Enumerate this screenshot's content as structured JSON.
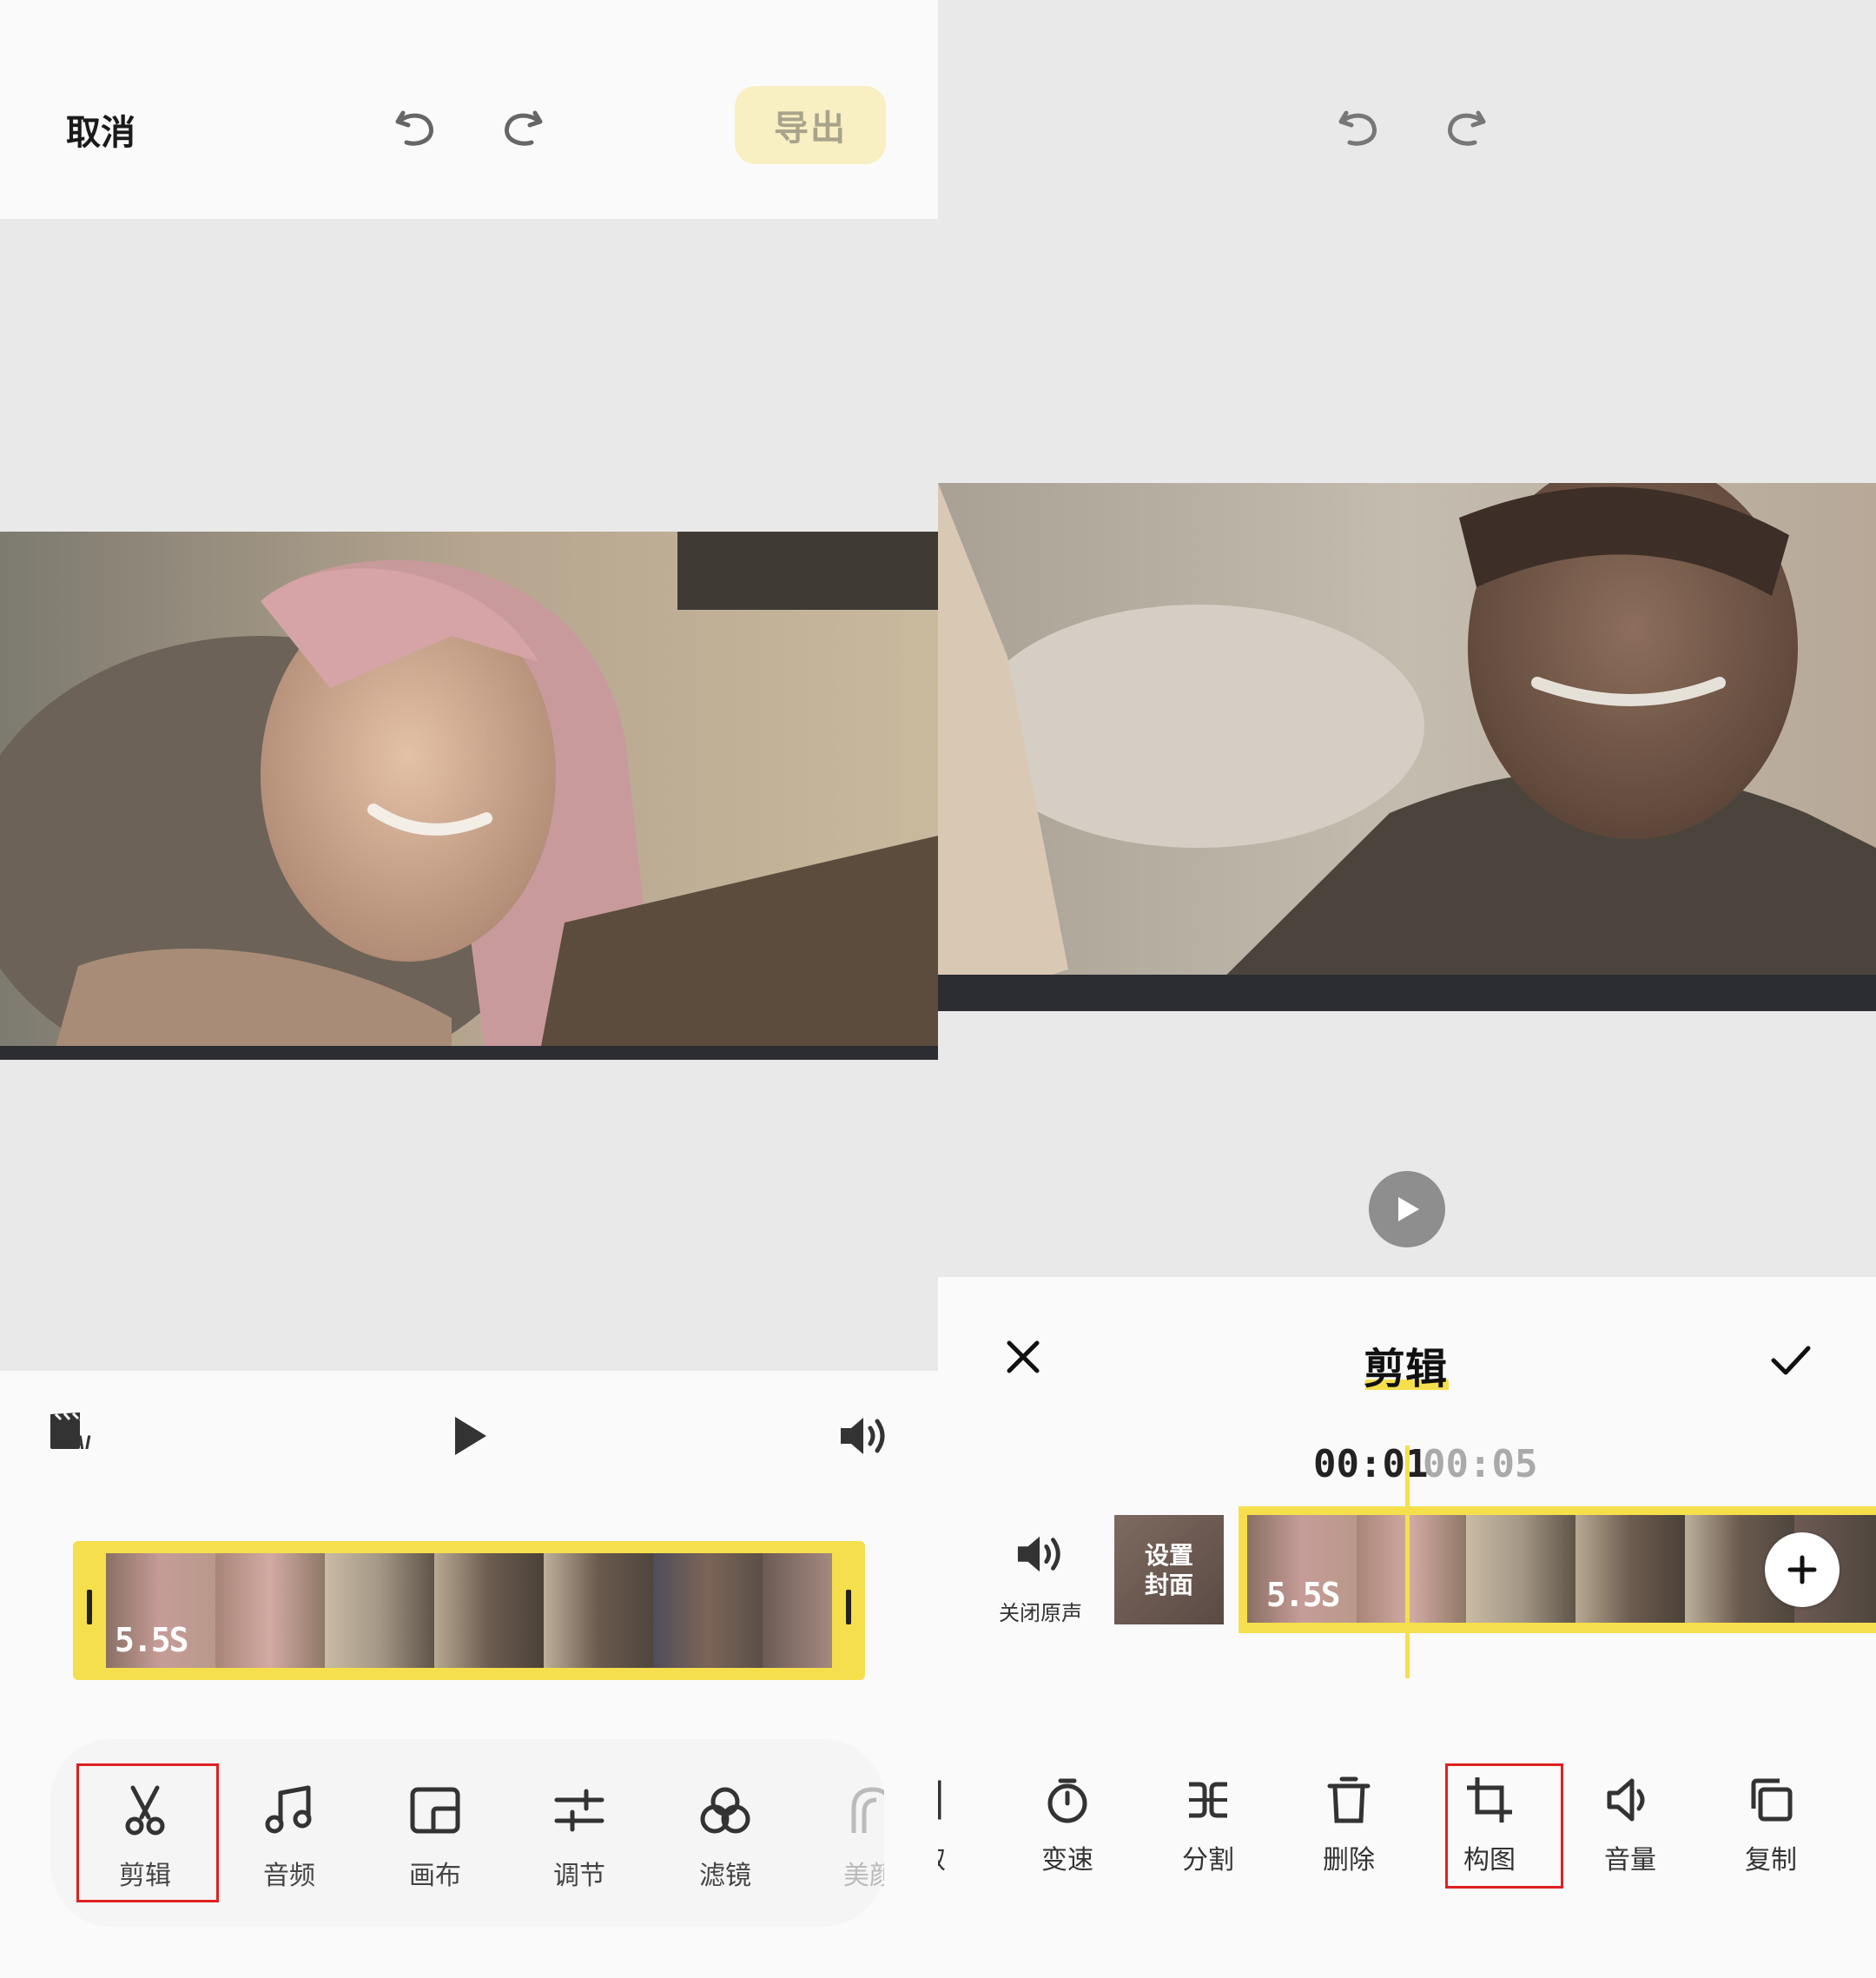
{
  "left": {
    "header": {
      "cancel": "取消",
      "export": "导出"
    },
    "clip_duration": "5.5S",
    "tools": [
      {
        "label": "剪辑",
        "icon": "scissors-icon"
      },
      {
        "label": "音频",
        "icon": "music-note-icon"
      },
      {
        "label": "画布",
        "icon": "canvas-icon"
      },
      {
        "label": "调节",
        "icon": "sliders-icon"
      },
      {
        "label": "滤镜",
        "icon": "filter-icon"
      },
      {
        "label": "美颜",
        "icon": "beauty-icon"
      }
    ]
  },
  "right": {
    "title": "剪辑",
    "time_current": "00:01",
    "time_total": "00:05",
    "mute_label": "关闭原声",
    "cover_label": "设置封面",
    "clip_duration": "5.5S",
    "tools": [
      {
        "label": "提取",
        "icon": "extract-icon"
      },
      {
        "label": "变速",
        "icon": "speed-timer-icon"
      },
      {
        "label": "分割",
        "icon": "split-icon"
      },
      {
        "label": "删除",
        "icon": "trash-icon"
      },
      {
        "label": "构图",
        "icon": "crop-icon"
      },
      {
        "label": "音量",
        "icon": "volume-icon"
      },
      {
        "label": "复制",
        "icon": "copy-icon"
      }
    ]
  },
  "colors": {
    "accent": "#f6df4d",
    "highlight": "#e02020"
  }
}
